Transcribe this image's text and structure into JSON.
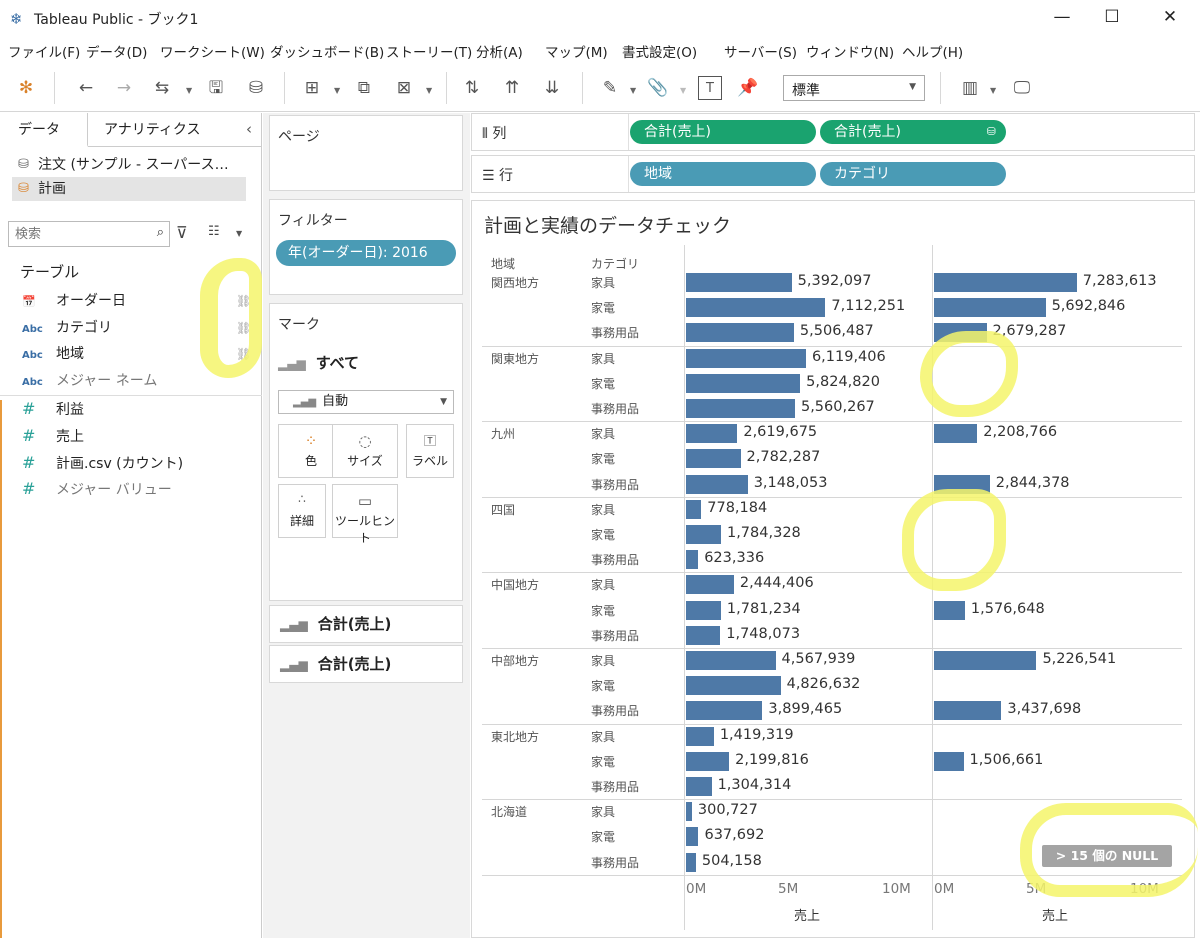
{
  "window": {
    "title": "Tableau Public - ブック1",
    "minimize": "—",
    "maximize": "☐",
    "close": "✕"
  },
  "menu": [
    "ファイル(F)",
    "データ(D)",
    "ワークシート(W)",
    "ダッシュボード(B)",
    "ストーリー(T)",
    "分析(A)",
    "マップ(M)",
    "書式設定(O)",
    "サーバー(S)",
    "ウィンドウ(N)",
    "ヘルプ(H)"
  ],
  "toolbar": {
    "fit_value": "標準"
  },
  "data_pane": {
    "tab_data": "データ",
    "tab_analytics": "アナリティクス",
    "datasources": [
      "注文 (サンプル - スーパース…",
      "計画"
    ],
    "search_placeholder": "検索",
    "section_table": "テーブル",
    "dimensions": [
      {
        "type": "📅",
        "name": "オーダー日"
      },
      {
        "type": "Abc",
        "name": "カテゴリ"
      },
      {
        "type": "Abc",
        "name": "地域"
      },
      {
        "type": "Abc",
        "name": "メジャー ネーム"
      }
    ],
    "measures": [
      {
        "type": "#",
        "name": "利益"
      },
      {
        "type": "#",
        "name": "売上"
      },
      {
        "type": "#",
        "name": "計画.csv (カウント)"
      },
      {
        "type": "#",
        "name": "メジャー バリュー"
      }
    ]
  },
  "pages_card": {
    "title": "ページ"
  },
  "filters_card": {
    "title": "フィルター",
    "filter": "年(オーダー日): 2016"
  },
  "marks_card": {
    "title": "マーク",
    "all": "すべて",
    "mark_type": "自動",
    "buttons": [
      "色",
      "サイズ",
      "ラベル",
      "詳細",
      "ツールヒント"
    ],
    "measures": [
      "合計(売上)",
      "合計(売上)"
    ]
  },
  "columns_shelf": {
    "label": "列",
    "pills": [
      "合計(売上)",
      "合計(売上)"
    ]
  },
  "rows_shelf": {
    "label": "行",
    "pills": [
      "地域",
      "カテゴリ"
    ]
  },
  "viz": {
    "title": "計画と実績のデータチェック",
    "header_region": "地域",
    "header_category": "カテゴリ",
    "null_badge": "> 15 個の NULL",
    "axis_title_left": "売上",
    "axis_title_right": "売上",
    "ticks": [
      "0M",
      "5M",
      "10M"
    ]
  },
  "chart_data": {
    "type": "bar",
    "categories": [
      "家具",
      "家電",
      "事務用品"
    ],
    "regions": [
      "関西地方",
      "関東地方",
      "九州",
      "四国",
      "中国地方",
      "中部地方",
      "東北地方",
      "北海道"
    ],
    "xlim": [
      0,
      11000000
    ],
    "series": [
      {
        "values": [
          [
            5392097,
            7112251,
            5506487
          ],
          [
            6119406,
            5824820,
            5560267
          ],
          [
            2619675,
            2782287,
            3148053
          ],
          [
            778184,
            1784328,
            623336
          ],
          [
            2444406,
            1781234,
            1748073
          ],
          [
            4567939,
            4826632,
            3899465
          ],
          [
            1419319,
            2199816,
            1304314
          ],
          [
            300727,
            637692,
            504158
          ]
        ]
      },
      {
        "values": [
          [
            7283613,
            5692846,
            2679287
          ],
          [
            null,
            null,
            null
          ],
          [
            2208766,
            null,
            2844378
          ],
          [
            null,
            null,
            null
          ],
          [
            null,
            1576648,
            null
          ],
          [
            5226541,
            null,
            3437698
          ],
          [
            null,
            1506661,
            null
          ],
          [
            null,
            null,
            null
          ]
        ]
      }
    ],
    "labels": [
      [
        [
          "5,392,097",
          "7,112,251",
          "5,506,487"
        ],
        [
          "6,119,406",
          "5,824,820",
          "5,560,267"
        ],
        [
          "2,619,675",
          "2,782,287",
          "3,148,053"
        ],
        [
          "778,184",
          "1,784,328",
          "623,336"
        ],
        [
          "2,444,406",
          "1,781,234",
          "1,748,073"
        ],
        [
          "4,567,939",
          "4,826,632",
          "3,899,465"
        ],
        [
          "1,419,319",
          "2,199,816",
          "1,304,314"
        ],
        [
          "300,727",
          "637,692",
          "504,158"
        ]
      ],
      [
        [
          "7,283,613",
          "5,692,846",
          "2,679,287"
        ],
        [
          null,
          null,
          null
        ],
        [
          "2,208,766",
          null,
          "2,844,378"
        ],
        [
          null,
          null,
          null
        ],
        [
          null,
          "1,576,648",
          null
        ],
        [
          "5,226,541",
          null,
          "3,437,698"
        ],
        [
          null,
          "1,506,661",
          null
        ],
        [
          null,
          null,
          null
        ]
      ]
    ],
    "bar_color": "#4e79a7",
    "grid": true
  },
  "colors": {
    "green_pill": "#1aa36f",
    "blue_pill": "#4a9bb5",
    "highlight": "#f5f56b"
  }
}
